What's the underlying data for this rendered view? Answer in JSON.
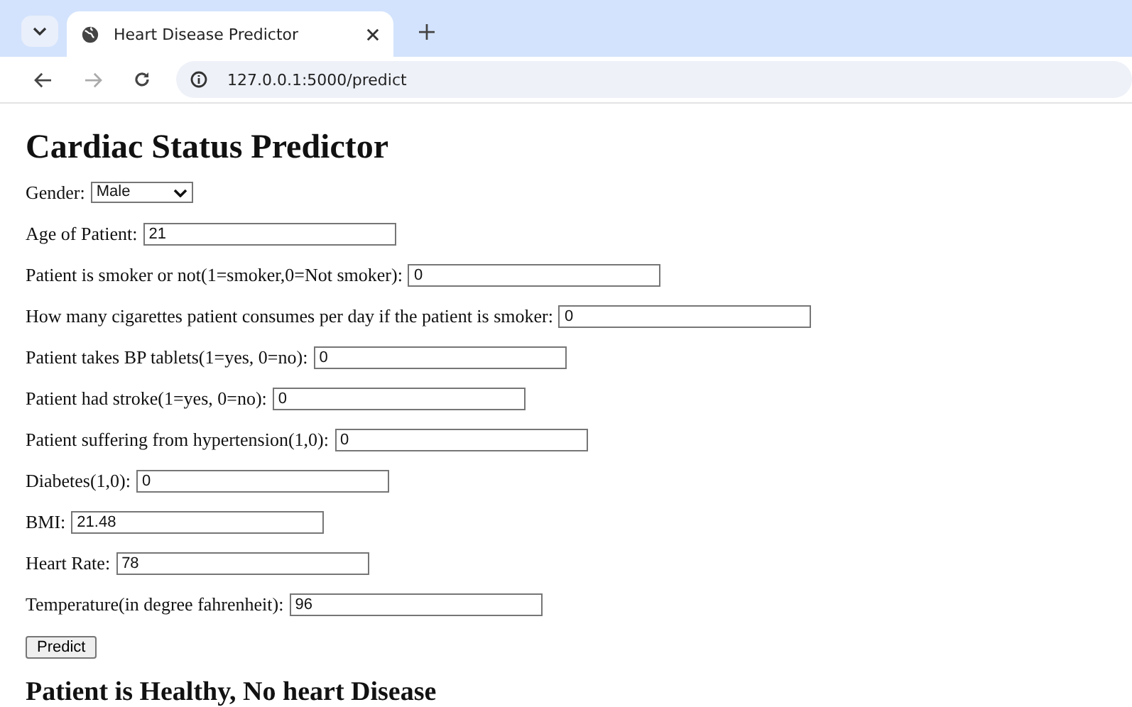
{
  "browser": {
    "tab": {
      "title": "Heart Disease Predictor",
      "selected": true
    },
    "address": "127.0.0.1:5000/predict"
  },
  "page": {
    "title": "Cardiac Status Predictor",
    "fields": [
      {
        "kind": "select",
        "label": "Gender:",
        "value": "Male"
      },
      {
        "kind": "text",
        "label": "Age of Patient:",
        "value": "21"
      },
      {
        "kind": "text",
        "label": "Patient is smoker or not(1=smoker,0=Not smoker):",
        "value": "0"
      },
      {
        "kind": "text",
        "label": "How many cigarettes patient consumes per day if the patient is smoker:",
        "value": "0"
      },
      {
        "kind": "text",
        "label": "Patient takes BP tablets(1=yes, 0=no):",
        "value": "0"
      },
      {
        "kind": "text",
        "label": "Patient had stroke(1=yes, 0=no):",
        "value": "0"
      },
      {
        "kind": "text",
        "label": "Patient suffering from hypertension(1,0):",
        "value": "0"
      },
      {
        "kind": "text",
        "label": "Diabetes(1,0):",
        "value": "0"
      },
      {
        "kind": "text",
        "label": "BMI:",
        "value": "21.48"
      },
      {
        "kind": "text",
        "label": "Heart Rate:",
        "value": "78"
      },
      {
        "kind": "text",
        "label": "Temperature(in degree fahrenheit):",
        "value": "96"
      }
    ],
    "button": "Predict",
    "result": "Patient is Healthy, No heart Disease"
  }
}
